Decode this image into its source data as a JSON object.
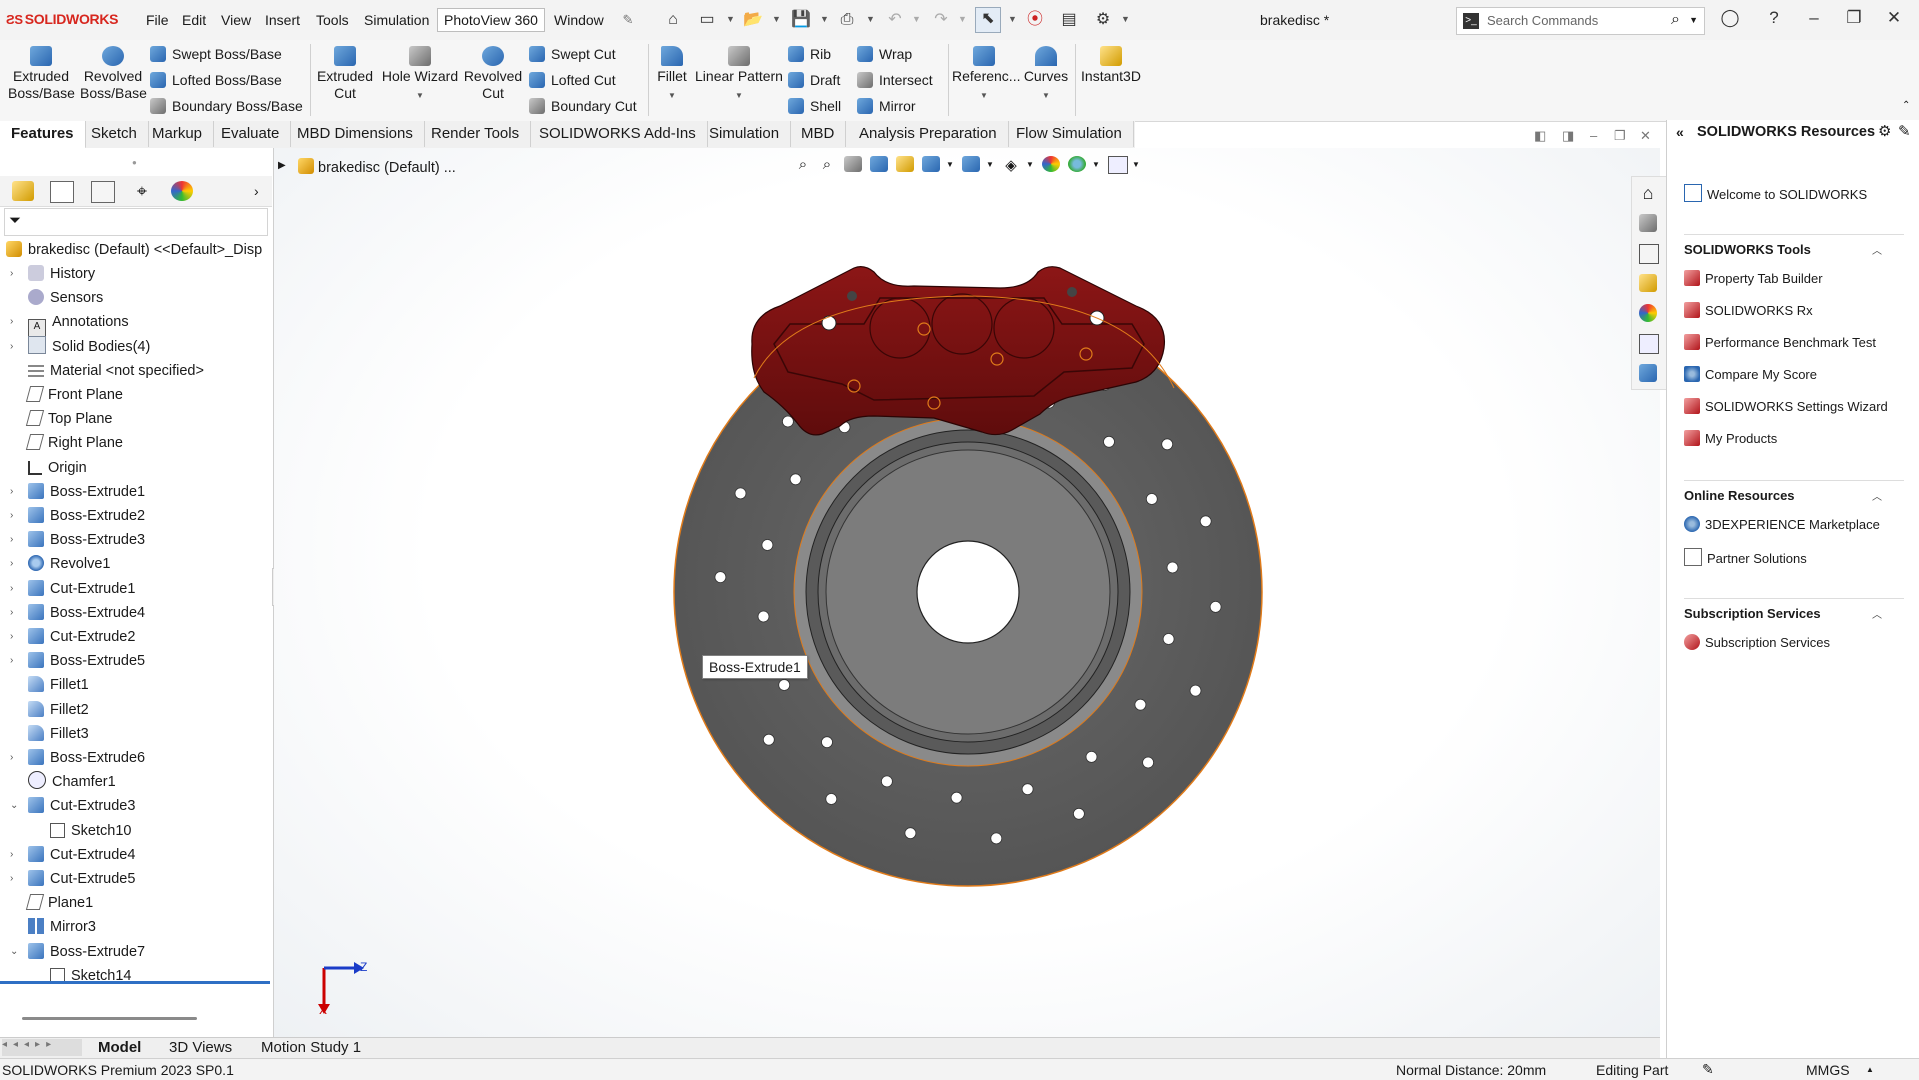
{
  "app": {
    "logo": "SOLIDWORKS",
    "document_title": "brakedisc *"
  },
  "menu": [
    "File",
    "Edit",
    "View",
    "Insert",
    "Tools",
    "Simulation",
    "PhotoView 360",
    "Window"
  ],
  "search": {
    "placeholder": "Search Commands"
  },
  "commands": {
    "extruded_boss": [
      "Extruded",
      "Boss/Base"
    ],
    "revolved_boss": [
      "Revolved",
      "Boss/Base"
    ],
    "swept_boss": "Swept Boss/Base",
    "lofted_boss": "Lofted Boss/Base",
    "boundary_boss": "Boundary Boss/Base",
    "extruded_cut": [
      "Extruded",
      "Cut"
    ],
    "hole_wizard": "Hole Wizard",
    "revolved_cut": [
      "Revolved",
      "Cut"
    ],
    "swept_cut": "Swept Cut",
    "lofted_cut": "Lofted Cut",
    "boundary_cut": "Boundary Cut",
    "fillet": "Fillet",
    "linear_pattern": "Linear Pattern",
    "rib": "Rib",
    "draft": "Draft",
    "shell": "Shell",
    "wrap": "Wrap",
    "intersect": "Intersect",
    "mirror": "Mirror",
    "reference": "Referenc...",
    "curves": "Curves",
    "instant3d": "Instant3D"
  },
  "tabs": [
    "Features",
    "Sketch",
    "Markup",
    "Evaluate",
    "MBD Dimensions",
    "Render Tools",
    "SOLIDWORKS Add-Ins",
    "Simulation",
    "MBD",
    "Analysis Preparation",
    "Flow Simulation"
  ],
  "tree": {
    "root": "brakedisc (Default) <<Default>_Disp",
    "items": [
      {
        "label": "History",
        "icon": "history-icon",
        "expand": "›"
      },
      {
        "label": "Sensors",
        "icon": "sensors-icon",
        "expand": ""
      },
      {
        "label": "Annotations",
        "icon": "annotations-icon",
        "expand": "›"
      },
      {
        "label": "Solid Bodies(4)",
        "icon": "solid-bodies-icon",
        "expand": "›"
      },
      {
        "label": "Material <not specified>",
        "icon": "material-icon",
        "expand": ""
      },
      {
        "label": "Front Plane",
        "icon": "plane-icon",
        "expand": ""
      },
      {
        "label": "Top Plane",
        "icon": "plane-icon",
        "expand": ""
      },
      {
        "label": "Right Plane",
        "icon": "plane-icon",
        "expand": ""
      },
      {
        "label": "Origin",
        "icon": "origin-icon",
        "expand": ""
      },
      {
        "label": "Boss-Extrude1",
        "icon": "extrude-icon",
        "expand": "›"
      },
      {
        "label": "Boss-Extrude2",
        "icon": "extrude-icon",
        "expand": "›"
      },
      {
        "label": "Boss-Extrude3",
        "icon": "extrude-icon",
        "expand": "›"
      },
      {
        "label": "Revolve1",
        "icon": "revolve-icon",
        "expand": "›"
      },
      {
        "label": "Cut-Extrude1",
        "icon": "cut-extrude-icon",
        "expand": "›"
      },
      {
        "label": "Boss-Extrude4",
        "icon": "extrude-icon",
        "expand": "›"
      },
      {
        "label": "Cut-Extrude2",
        "icon": "cut-extrude-icon",
        "expand": "›"
      },
      {
        "label": "Boss-Extrude5",
        "icon": "extrude-icon",
        "expand": "›"
      },
      {
        "label": "Fillet1",
        "icon": "fillet-icon",
        "expand": ""
      },
      {
        "label": "Fillet2",
        "icon": "fillet-icon",
        "expand": ""
      },
      {
        "label": "Fillet3",
        "icon": "fillet-icon",
        "expand": ""
      },
      {
        "label": "Boss-Extrude6",
        "icon": "extrude-icon",
        "expand": "›"
      },
      {
        "label": "Chamfer1",
        "icon": "chamfer-icon",
        "expand": ""
      },
      {
        "label": "Cut-Extrude3",
        "icon": "cut-extrude-icon",
        "expand": "⌄"
      },
      {
        "label": "Sketch10",
        "icon": "sketch-icon",
        "expand": "",
        "child": true
      },
      {
        "label": "Cut-Extrude4",
        "icon": "cut-extrude-icon",
        "expand": "›"
      },
      {
        "label": "Cut-Extrude5",
        "icon": "cut-extrude-icon",
        "expand": "›"
      },
      {
        "label": "Plane1",
        "icon": "plane-icon",
        "expand": ""
      },
      {
        "label": "Mirror3",
        "icon": "mirror-icon",
        "expand": ""
      },
      {
        "label": "Boss-Extrude7",
        "icon": "extrude-icon",
        "expand": "⌄"
      },
      {
        "label": "Sketch14",
        "icon": "sketch-icon",
        "expand": "",
        "child": true
      }
    ]
  },
  "viewport": {
    "breadcrumb": "brakedisc (Default) ...",
    "tooltip": "Boss-Extrude1",
    "triad": {
      "z": "Z",
      "x": "X"
    }
  },
  "bottom_tabs": [
    "Model",
    "3D Views",
    "Motion Study 1"
  ],
  "status": {
    "product": "SOLIDWORKS Premium 2023 SP0.1",
    "normal_distance": "Normal Distance: 20mm",
    "mode": "Editing Part",
    "units": "MMGS"
  },
  "resources": {
    "title": "SOLIDWORKS Resources",
    "welcome": "Welcome to SOLIDWORKS",
    "tools_head": "SOLIDWORKS Tools",
    "tools": [
      "Property Tab Builder",
      "SOLIDWORKS Rx",
      "Performance Benchmark Test",
      "Compare My Score",
      "SOLIDWORKS Settings Wizard",
      "My Products"
    ],
    "online_head": "Online Resources",
    "online": [
      "3DEXPERIENCE Marketplace",
      "Partner Solutions"
    ],
    "subs_head": "Subscription Services",
    "subs": [
      "Subscription Services"
    ]
  },
  "colors": {
    "brand": "#d7261e",
    "caliper": "#7a1212",
    "disc": "#5f5f5f",
    "highlight": "#e07b1a"
  }
}
